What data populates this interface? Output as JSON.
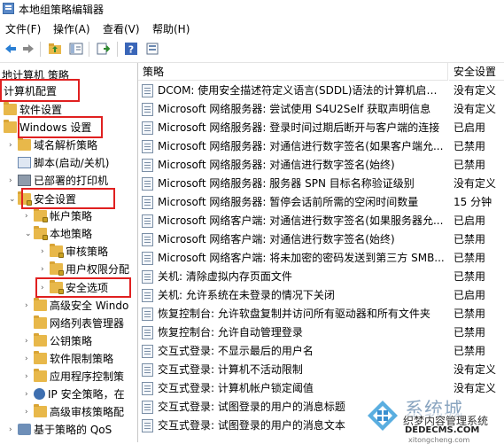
{
  "window": {
    "title": "本地组策略编辑器"
  },
  "menu": [
    "文件(F)",
    "操作(A)",
    "查看(V)",
    "帮助(H)"
  ],
  "toolbar": {
    "icons": [
      "back-arrow-icon",
      "forward-arrow-icon",
      "folder-up-icon",
      "show-hide-tree-icon",
      "export-list-icon",
      "help-icon",
      "properties-icon"
    ]
  },
  "tree": {
    "header": "地计算机 策略",
    "items": [
      {
        "label": "计算机配置",
        "level": 0,
        "icon": "computer-icon",
        "highlighted": true
      },
      {
        "label": "软件设置",
        "level": 1,
        "icon": "folder-icon"
      },
      {
        "label": "Windows 设置",
        "level": 1,
        "icon": "folder-icon",
        "highlighted": true
      },
      {
        "label": "域名解析策略",
        "level": 2,
        "icon": "folder-icon"
      },
      {
        "label": "脚本(启动/关机)",
        "level": 2,
        "icon": "script-icon"
      },
      {
        "label": "已部署的打印机",
        "level": 2,
        "icon": "printer-icon"
      },
      {
        "label": "安全设置",
        "level": 2,
        "icon": "security-folder-icon",
        "highlighted": true
      },
      {
        "label": "帐户策略",
        "level": 3,
        "icon": "folder-icon"
      },
      {
        "label": "本地策略",
        "level": 3,
        "icon": "folder-icon"
      },
      {
        "label": "审核策略",
        "level": 4,
        "icon": "folder-icon"
      },
      {
        "label": "用户权限分配",
        "level": 4,
        "icon": "folder-icon"
      },
      {
        "label": "安全选项",
        "level": 4,
        "icon": "folder-icon",
        "highlighted": true,
        "selected": true
      },
      {
        "label": "高级安全 Windo",
        "level": 3,
        "icon": "folder-icon"
      },
      {
        "label": "网络列表管理器",
        "level": 3,
        "icon": "folder-icon"
      },
      {
        "label": "公钥策略",
        "level": 3,
        "icon": "folder-icon"
      },
      {
        "label": "软件限制策略",
        "level": 3,
        "icon": "folder-icon"
      },
      {
        "label": "应用程序控制策",
        "level": 3,
        "icon": "folder-icon"
      },
      {
        "label": "IP 安全策略，在",
        "level": 3,
        "icon": "ip-security-icon"
      },
      {
        "label": "高级审核策略配",
        "level": 3,
        "icon": "folder-icon"
      },
      {
        "label": "基于策略的 QoS",
        "level": 2,
        "icon": "qos-icon"
      }
    ]
  },
  "columns": {
    "policy": "策略",
    "setting": "安全设置"
  },
  "policies": [
    {
      "name": "DCOM: 使用安全描述符定义语言(SDDL)语法的计算机启动...",
      "value": "没有定义"
    },
    {
      "name": "Microsoft 网络服务器: 尝试使用 S4U2Self 获取声明信息",
      "value": "没有定义"
    },
    {
      "name": "Microsoft 网络服务器: 登录时间过期后断开与客户端的连接",
      "value": "已启用"
    },
    {
      "name": "Microsoft 网络服务器: 对通信进行数字签名(如果客户端允...",
      "value": "已禁用"
    },
    {
      "name": "Microsoft 网络服务器: 对通信进行数字签名(始终)",
      "value": "已禁用"
    },
    {
      "name": "Microsoft 网络服务器: 服务器 SPN 目标名称验证级别",
      "value": "没有定义"
    },
    {
      "name": "Microsoft 网络服务器: 暂停会话前所需的空闲时间数量",
      "value": "15 分钟"
    },
    {
      "name": "Microsoft 网络客户端: 对通信进行数字签名(如果服务器允...",
      "value": "已启用"
    },
    {
      "name": "Microsoft 网络客户端: 对通信进行数字签名(始终)",
      "value": "已禁用"
    },
    {
      "name": "Microsoft 网络客户端: 将未加密的密码发送到第三方 SMB...",
      "value": "已禁用"
    },
    {
      "name": "关机: 清除虚拟内存页面文件",
      "value": "已禁用"
    },
    {
      "name": "关机: 允许系统在未登录的情况下关闭",
      "value": "已启用"
    },
    {
      "name": "恢复控制台: 允许软盘复制并访问所有驱动器和所有文件夹",
      "value": "已禁用"
    },
    {
      "name": "恢复控制台: 允许自动管理登录",
      "value": "已禁用"
    },
    {
      "name": "交互式登录: 不显示最后的用户名",
      "value": "已禁用"
    },
    {
      "name": "交互式登录: 计算机不活动限制",
      "value": "没有定义"
    },
    {
      "name": "交互式登录: 计算机帐户锁定阈值",
      "value": "没有定义"
    },
    {
      "name": "交互式登录: 试图登录的用户的消息标题",
      "value": ""
    },
    {
      "name": "交互式登录: 试图登录的用户的消息文本",
      "value": ""
    }
  ],
  "watermark": {
    "big": "系统城",
    "line1": "织梦内容管理系统",
    "line2": "DEDECMS.COM",
    "line3": "xitongcheng.com"
  }
}
